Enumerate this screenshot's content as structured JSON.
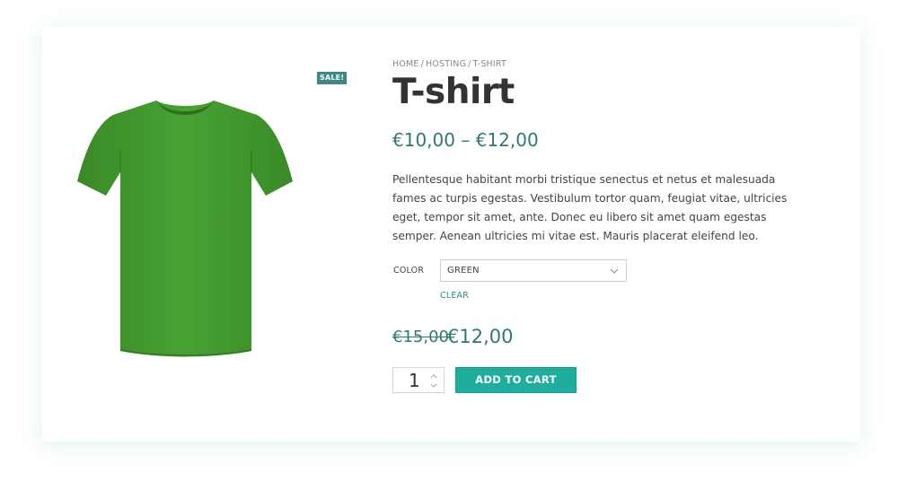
{
  "badge": {
    "sale_label": "SALE!"
  },
  "breadcrumb": {
    "items": [
      "HOME",
      "HOSTING",
      "T-SHIRT"
    ],
    "separator": "/"
  },
  "product": {
    "title": "T-shirt",
    "price_range": "€10,00 – €12,00",
    "description": "Pellentesque habitant morbi tristique senectus et netus et malesuada fames ac turpis egestas. Vestibulum tortor quam, feugiat vitae, ultricies eget, tempor sit amet, ante. Donec eu libero sit amet quam egestas semper. Aenean ultricies mi vitae est. Mauris placerat eleifend leo.",
    "image_icon": "tshirt-icon",
    "image_color": "#43982f"
  },
  "variation": {
    "label": "COLOR",
    "selected": "GREEN",
    "clear_label": "CLEAR"
  },
  "pricing": {
    "old_price": "€15,00",
    "new_price": "€12,00"
  },
  "cart": {
    "quantity": "1",
    "button_label": "ADD TO CART"
  },
  "colors": {
    "accent": "#1fae9d",
    "price": "#2e7a72",
    "badge": "#3d8a82"
  }
}
